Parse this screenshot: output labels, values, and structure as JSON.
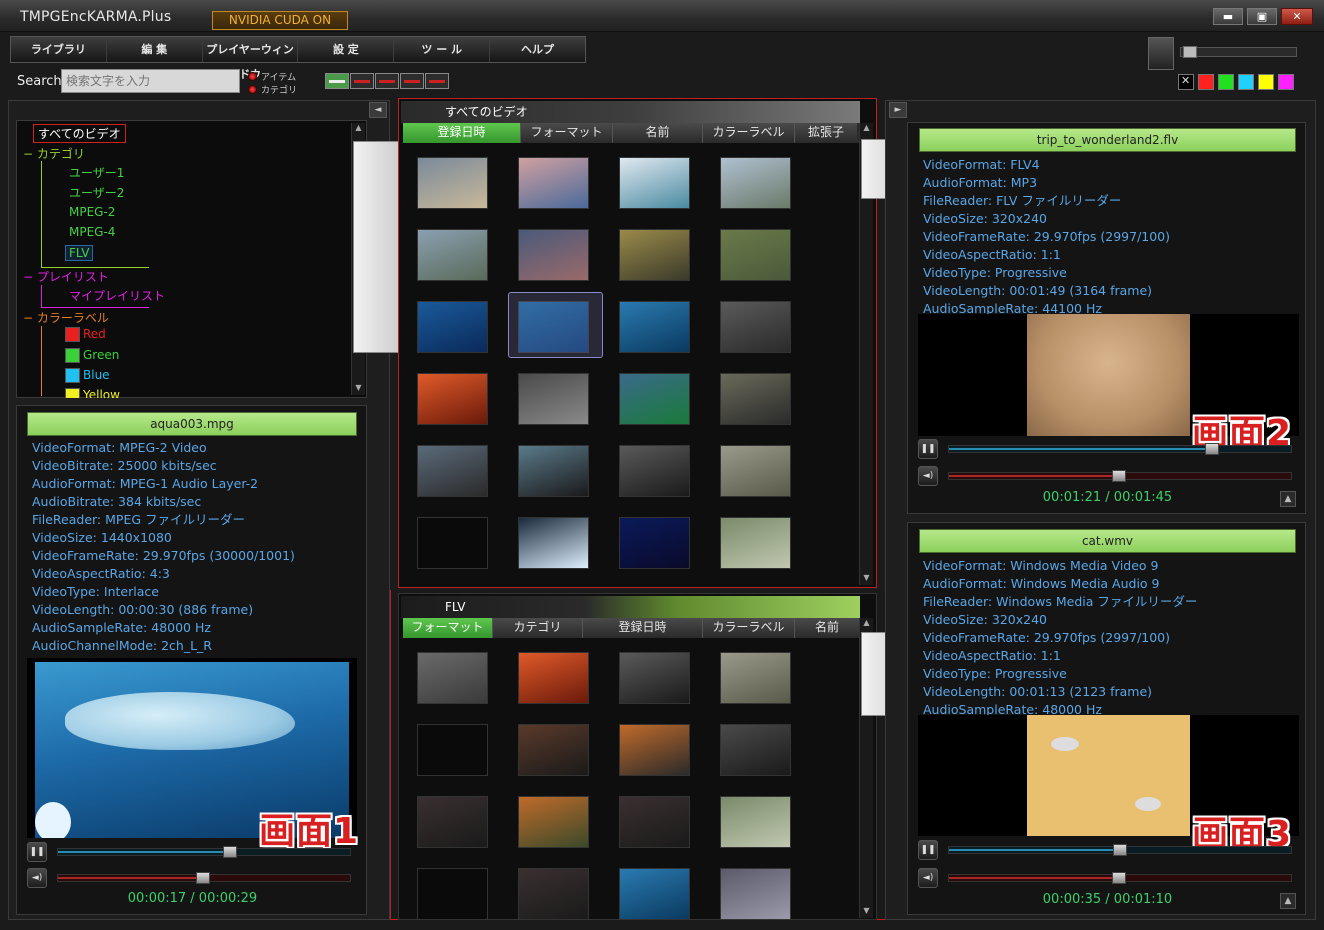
{
  "window": {
    "app_title": "TMPGEncKARMA.Plus",
    "cuda_badge": "NVIDIA CUDA ON",
    "min_label": "▬",
    "max_label": "▣",
    "close_label": "✕"
  },
  "menu": {
    "items": [
      {
        "label": "ライブラリ"
      },
      {
        "label": "編 集"
      },
      {
        "label": "プレイヤーウィンドウ"
      },
      {
        "label": "設 定"
      },
      {
        "label": "ツ ー ル"
      },
      {
        "label": "ヘルプ"
      }
    ]
  },
  "search": {
    "label": "Search",
    "placeholder": "検索文字を入力",
    "option_item": "アイテム",
    "option_category": "カテゴリ"
  },
  "colors": {
    "swatches": [
      "#000000",
      "#ff2020",
      "#20e020",
      "#20d0ff",
      "#ffff00",
      "#ff20ff"
    ],
    "accent_green": "#8cd05c",
    "info_text": "#5aa6e6",
    "time_text": "#3cd06a",
    "red_frame": "#c02020"
  },
  "tree": {
    "all_videos": "すべてのビデオ",
    "category": "− カテゴリ",
    "user1": "ユーザー1",
    "user2": "ユーザー2",
    "mpeg2": "MPEG-2",
    "mpeg4": "MPEG-4",
    "flv": "FLV",
    "playlist": "− プレイリスト",
    "my_playlist": "マイプレイリスト",
    "color_label": "− カラーラベル",
    "red": "Red",
    "green": "Green",
    "blue": "Blue",
    "yellow": "Yellow"
  },
  "player1": {
    "file": "aqua003.mpg",
    "lines": [
      "VideoFormat: MPEG-2 Video",
      "VideoBitrate: 25000 kbits/sec",
      "AudioFormat: MPEG-1 Audio Layer-2",
      "AudioBitrate: 384 kbits/sec",
      "FileReader: MPEG ファイルリーダー",
      "VideoSize: 1440x1080",
      "VideoFrameRate: 29.970fps (30000/1001)",
      "VideoAspectRatio: 4:3",
      "VideoType: Interlace",
      "VideoLength: 00:00:30 (886 frame)",
      "AudioSampleRate: 48000 Hz",
      "AudioChannelMode: 2ch_L_R"
    ],
    "time": "00:00:17 / 00:00:29",
    "screen_label": "画面1",
    "progress": 0.59
  },
  "player2": {
    "file": "trip_to_wonderland2.flv",
    "lines": [
      "VideoFormat: FLV4",
      "AudioFormat: MP3",
      "FileReader: FLV ファイルリーダー",
      "VideoSize: 320x240",
      "VideoFrameRate: 29.970fps (2997/100)",
      "VideoAspectRatio: 1:1",
      "VideoType: Progressive",
      "VideoLength: 00:01:49 (3164 frame)",
      "AudioSampleRate: 44100 Hz"
    ],
    "time": "00:01:21 / 00:01:45",
    "screen_label": "画面2",
    "progress": 0.77
  },
  "player3": {
    "file": "cat.wmv",
    "lines": [
      "VideoFormat: Windows Media Video 9",
      "AudioFormat: Windows Media Audio 9",
      "FileReader: Windows Media ファイルリーダー",
      "VideoSize: 320x240",
      "VideoFrameRate: 29.970fps (2997/100)",
      "VideoAspectRatio: 1:1",
      "VideoType: Progressive",
      "VideoLength: 00:01:13 (2123 frame)",
      "AudioSampleRate: 48000 Hz"
    ],
    "time": "00:00:35 / 00:01:10",
    "screen_label": "画面3",
    "progress": 0.5
  },
  "grid_top": {
    "title": "すべてのビデオ",
    "columns": [
      "登録日時",
      "フォーマット",
      "名前",
      "カラーラベル",
      "拡張子"
    ]
  },
  "grid_bottom": {
    "title": "FLV",
    "columns": [
      "フォーマット",
      "カテゴリ",
      "登録日時",
      "カラーラベル",
      "名前"
    ]
  },
  "controls": {
    "pause": "❚❚",
    "volume": "◄)",
    "up": "▲",
    "scroll_up": "▲",
    "scroll_down": "▼",
    "collapse_left": "◄",
    "expand_right": "►"
  }
}
